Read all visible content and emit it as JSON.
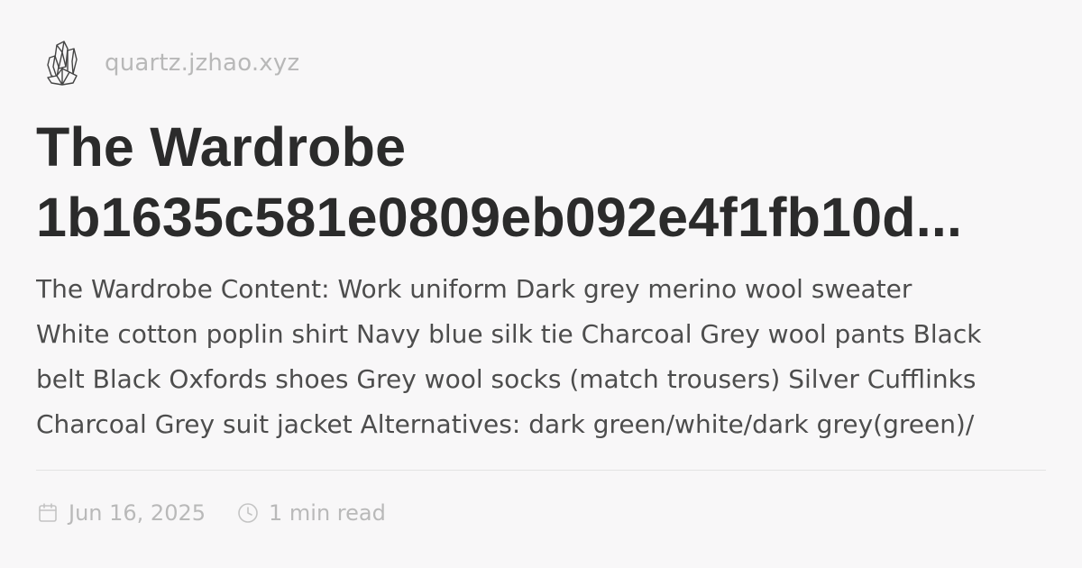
{
  "site": {
    "name": "quartz.jzhao.xyz",
    "logo_icon": "quartz-crystal-icon"
  },
  "article": {
    "title_line_1": "The Wardrobe",
    "title_line_2": "1b1635c581e0809eb092e4f1fb10d...",
    "description_lines": [
      "The Wardrobe Content: Work uniform Dark grey merino wool sweater",
      "White cotton poplin shirt Navy blue silk tie Charcoal Grey wool pants Black",
      "belt Black Oxfords shoes Grey wool socks (match trousers) Silver Cufflinks",
      "Charcoal Grey suit jacket Alternatives: dark green/white/dark grey(green)/"
    ]
  },
  "meta": {
    "date": "Jun 16, 2025",
    "date_icon": "calendar-icon",
    "reading_time": "1 min read",
    "reading_time_icon": "clock-icon"
  },
  "colors": {
    "background": "#f8f7f8",
    "title": "#2b2b2b",
    "body_text": "#4d4d4d",
    "muted": "#b9b9b9",
    "divider": "#e3e3e3"
  }
}
